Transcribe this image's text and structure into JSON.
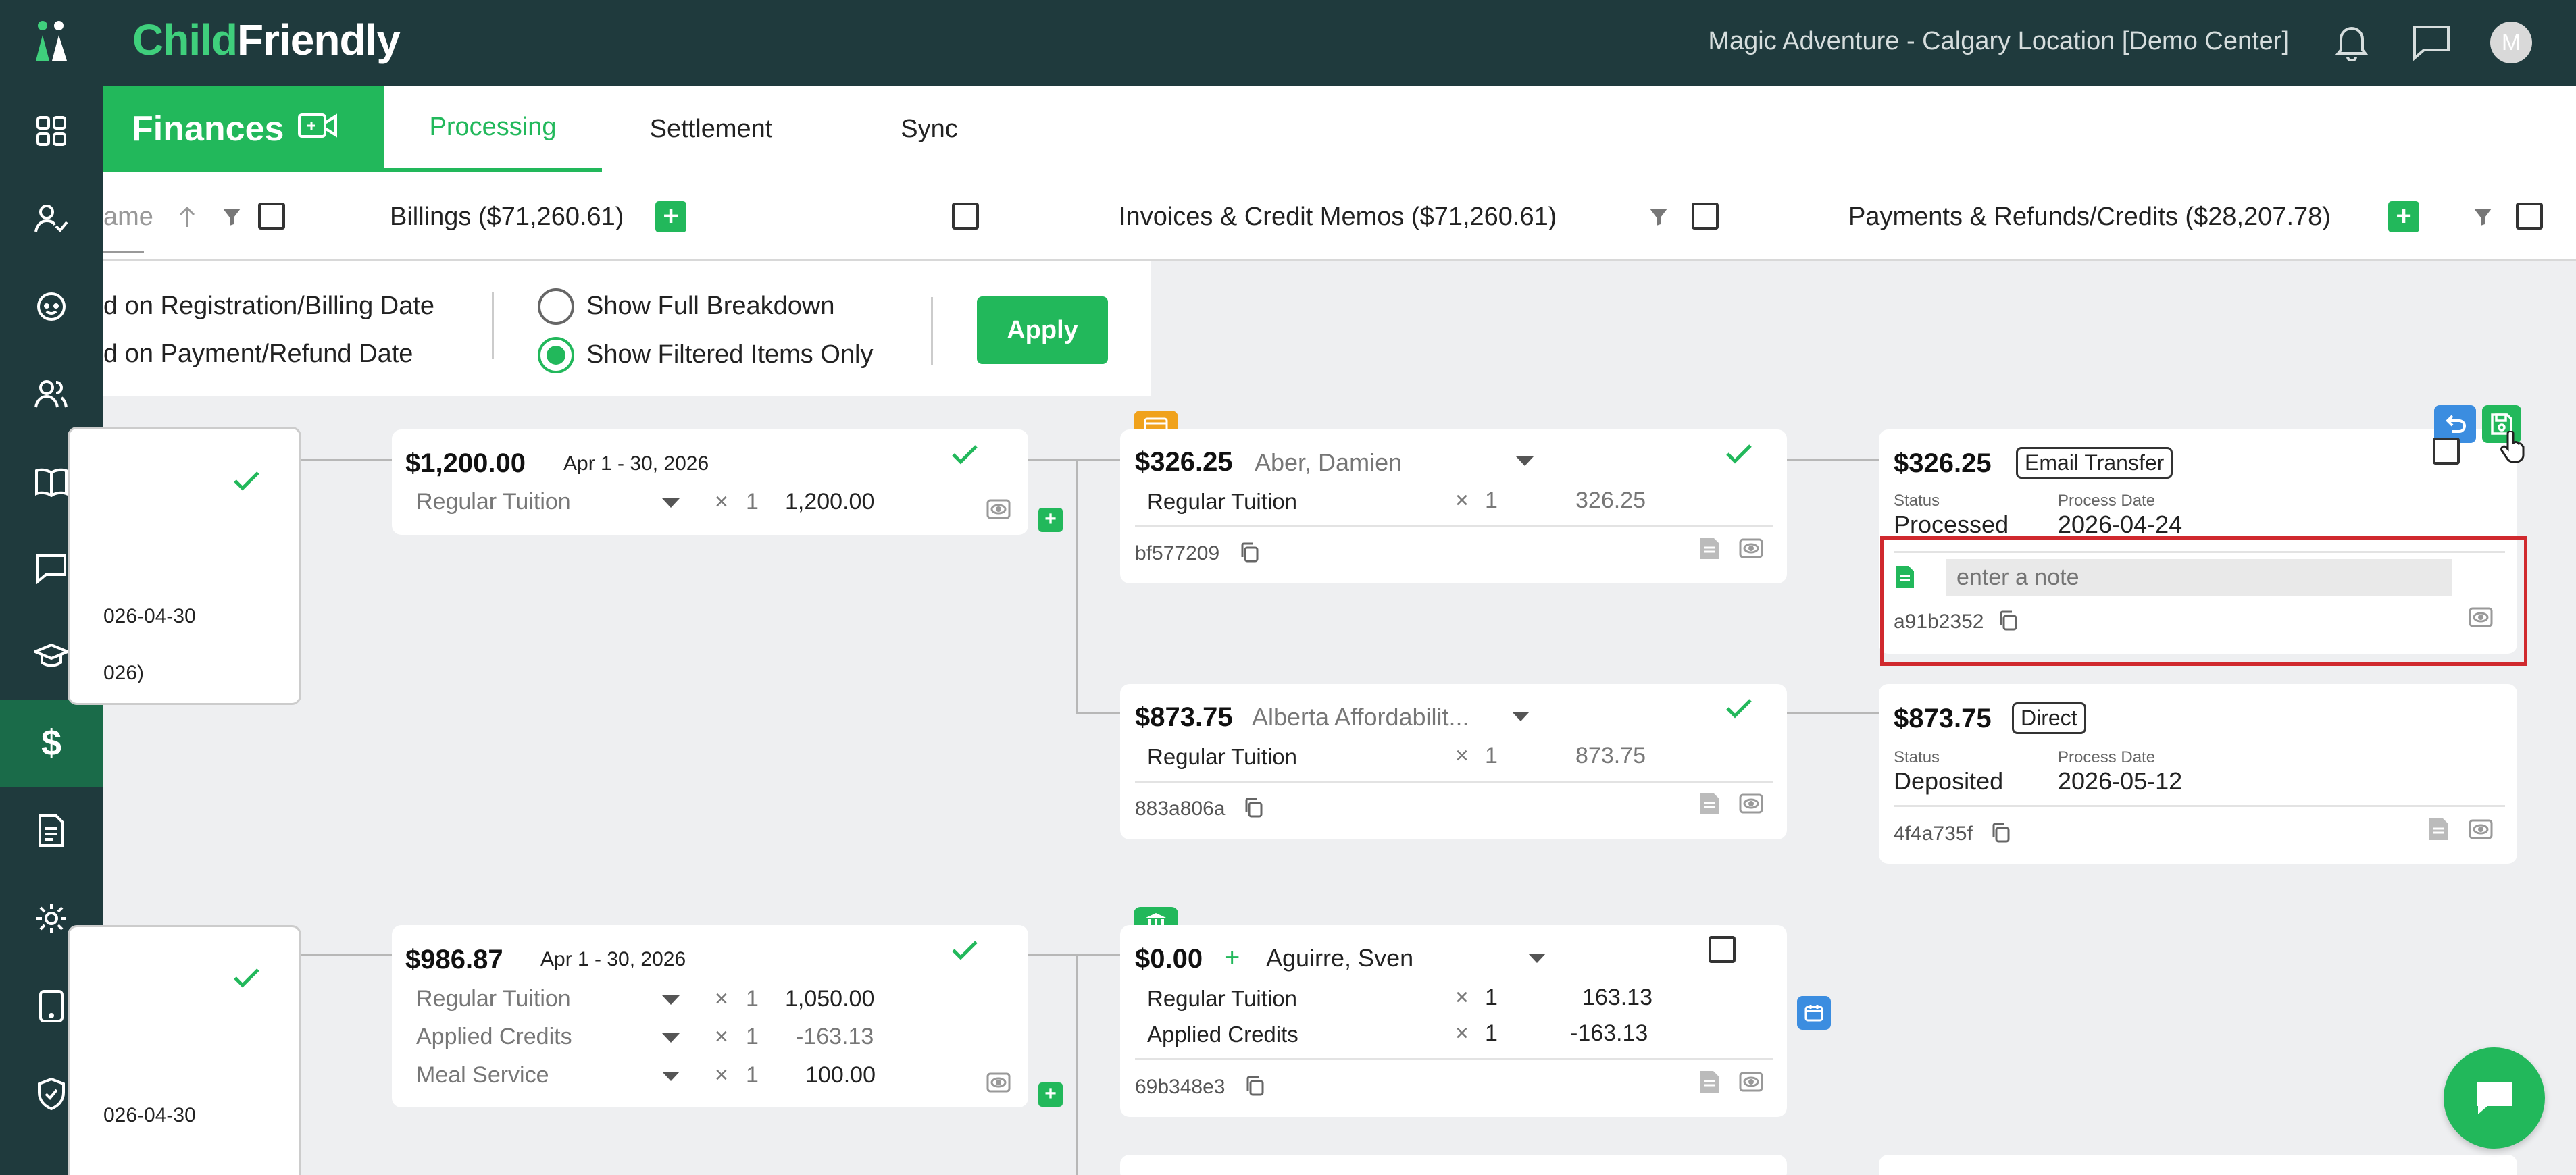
{
  "app": {
    "logo_a": "Chi",
    "logo_b": "l",
    "logo_c": "d",
    "logo_d": "Friend",
    "logo_e": "l",
    "logo_f": "y",
    "center": "Magic Adventure - Calgary Location [Demo Center]",
    "avatar": "M"
  },
  "section": {
    "title": "Finances"
  },
  "tabs": [
    {
      "label": "Processing"
    },
    {
      "label": "Settlement"
    },
    {
      "label": "Sync"
    }
  ],
  "columns": {
    "name_partial": "ame",
    "billings": "Billings ($71,260.61)",
    "invoices": "Invoices & Credit Memos ($71,260.61)",
    "payments": "Payments & Refunds/Credits ($28,207.78)"
  },
  "filter": {
    "opt1": "d on Registration/Billing Date",
    "opt2": "d on Payment/Refund Date",
    "radio1": "Show Full Breakdown",
    "radio2": "Show Filtered Items Only",
    "apply": "Apply"
  },
  "left_cards": [
    {
      "date": "026-04-30",
      "extra": "026)"
    },
    {
      "date": "026-04-30"
    }
  ],
  "billings": [
    {
      "amount": "$1,200.00",
      "period": "Apr 1 - 30, 2026",
      "lines": [
        {
          "name": "Regular Tuition",
          "mult": "×",
          "qty": "1",
          "val": "1,200.00"
        }
      ]
    },
    {
      "amount": "$986.87",
      "period": "Apr 1 - 30, 2026",
      "lines": [
        {
          "name": "Regular Tuition",
          "mult": "×",
          "qty": "1",
          "val": "1,050.00"
        },
        {
          "name": "Applied Credits",
          "mult": "×",
          "qty": "1",
          "val": "-163.13"
        },
        {
          "name": "Meal Service",
          "mult": "×",
          "qty": "1",
          "val": "100.00"
        }
      ]
    }
  ],
  "invoices": [
    {
      "amount": "$326.25",
      "name": "Aber, Damien",
      "lines": [
        {
          "name": "Regular Tuition",
          "mult": "×",
          "qty": "1",
          "val": "326.25"
        }
      ],
      "id": "bf577209"
    },
    {
      "amount": "$873.75",
      "name": "Alberta Affordabilit...",
      "lines": [
        {
          "name": "Regular Tuition",
          "mult": "×",
          "qty": "1",
          "val": "873.75"
        }
      ],
      "id": "883a806a"
    },
    {
      "amount": "$0.00",
      "plus": "+",
      "name": "Aguirre, Sven",
      "lines": [
        {
          "name": "Regular Tuition",
          "mult": "×",
          "qty": "1",
          "val": "163.13"
        },
        {
          "name": "Applied Credits",
          "mult": "×",
          "qty": "1",
          "val": "-163.13"
        }
      ],
      "id": "69b348e3"
    }
  ],
  "payments": [
    {
      "amount": "$326.25",
      "method": "Email Transfer",
      "status_label": "Status",
      "status": "Processed",
      "date_label": "Process Date",
      "date": "2026-04-24",
      "note_placeholder": "enter a note",
      "id": "a91b2352"
    },
    {
      "amount": "$873.75",
      "method": "Direct",
      "status_label": "Status",
      "status": "Deposited",
      "date_label": "Process Date",
      "date": "2026-05-12",
      "id": "4f4a735f"
    }
  ],
  "colors": {
    "green": "#22b85b",
    "dark": "#1f3a3d",
    "blue": "#3b8de0",
    "highlight": "#d0292e"
  }
}
